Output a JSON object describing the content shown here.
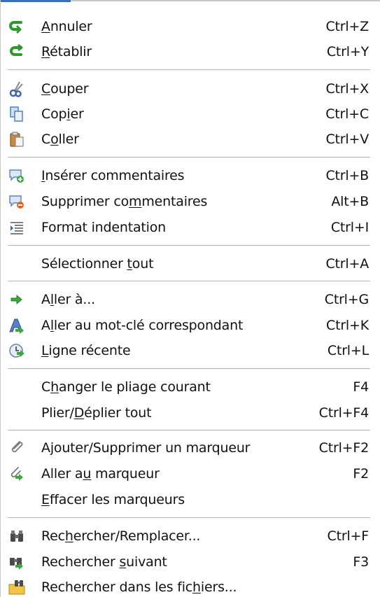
{
  "menu": {
    "items": [
      {
        "key": "undo",
        "label": "Annuler",
        "mnemonic": 0,
        "shortcut": "Ctrl+Z",
        "icon": "undo-icon"
      },
      {
        "key": "redo",
        "label": "Rétablir",
        "mnemonic": 0,
        "shortcut": "Ctrl+Y",
        "icon": "redo-icon"
      },
      {
        "key": "cut",
        "label": "Couper",
        "mnemonic": 0,
        "shortcut": "Ctrl+X",
        "icon": "cut-icon"
      },
      {
        "key": "copy",
        "label": "Copier",
        "mnemonic": 3,
        "shortcut": "Ctrl+C",
        "icon": "copy-icon"
      },
      {
        "key": "paste",
        "label": "Coller",
        "mnemonic": 1,
        "shortcut": "Ctrl+V",
        "icon": "paste-icon"
      },
      {
        "key": "insert-comments",
        "label": "Insérer commentaires",
        "mnemonic": 0,
        "shortcut": "Ctrl+B",
        "icon": "insert-comment-icon"
      },
      {
        "key": "remove-comments",
        "label": "Supprimer commentaires",
        "mnemonic": 12,
        "shortcut": "Alt+B",
        "icon": "remove-comment-icon"
      },
      {
        "key": "format-indent",
        "label": "Format indentation",
        "mnemonic": -1,
        "shortcut": "Ctrl+I",
        "icon": "indent-icon"
      },
      {
        "key": "select-all",
        "label": "Sélectionner tout",
        "mnemonic": 13,
        "shortcut": "Ctrl+A",
        "icon": ""
      },
      {
        "key": "goto",
        "label": "Aller à...",
        "mnemonic": 1,
        "shortcut": "Ctrl+G",
        "icon": "goto-arrow-icon"
      },
      {
        "key": "goto-matching",
        "label": "Aller au mot-clé correspondant",
        "mnemonic": 1,
        "shortcut": "Ctrl+K",
        "icon": "matching-keyword-icon"
      },
      {
        "key": "recent-line",
        "label": "Ligne récente",
        "mnemonic": 0,
        "shortcut": "Ctrl+L",
        "icon": "recent-line-icon"
      },
      {
        "key": "toggle-fold",
        "label": "Changer le pliage courant",
        "mnemonic": 1,
        "shortcut": "F4",
        "icon": ""
      },
      {
        "key": "fold-all",
        "label": "Plier/Déplier tout",
        "mnemonic": 6,
        "shortcut": "Ctrl+F4",
        "icon": ""
      },
      {
        "key": "toggle-marker",
        "label": "Ajouter/Supprimer un marqueur",
        "mnemonic": 1,
        "shortcut": "Ctrl+F2",
        "icon": "marker-toggle-icon"
      },
      {
        "key": "goto-marker",
        "label": "Aller au marqueur",
        "mnemonic": 7,
        "shortcut": "F2",
        "icon": "goto-marker-icon"
      },
      {
        "key": "clear-markers",
        "label": "Effacer les marqueurs",
        "mnemonic": 0,
        "shortcut": "",
        "icon": ""
      },
      {
        "key": "find-replace",
        "label": "Rechercher/Remplacer...",
        "mnemonic": 3,
        "shortcut": "Ctrl+F",
        "icon": "binoculars-icon"
      },
      {
        "key": "find-next",
        "label": "Rechercher suivant",
        "mnemonic": 11,
        "shortcut": "F3",
        "icon": "binoculars-next-icon"
      },
      {
        "key": "find-in-files",
        "label": "Rechercher dans les fichiers...",
        "mnemonic": 23,
        "shortcut": "",
        "icon": "folder-search-icon"
      }
    ]
  },
  "colors": {
    "accent": "#3b6db3",
    "separator": "#b8b8b8",
    "undo_green": "#2e9a2e",
    "arrow_green": "#3aa83a"
  }
}
